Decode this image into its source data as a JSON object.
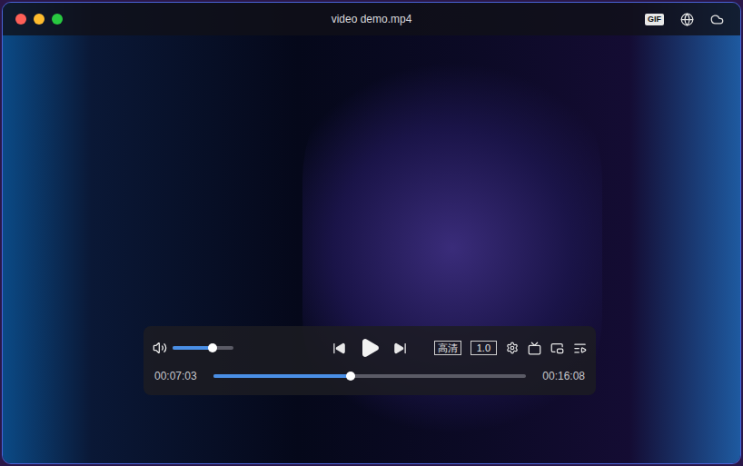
{
  "window": {
    "title": "video demo.mp4"
  },
  "toolbar": {
    "badges": [
      "GIF"
    ]
  },
  "player": {
    "volume": {
      "level": 0.66
    },
    "playing": false,
    "quality": "高清",
    "speed": "1.0",
    "current_time": "00:07:03",
    "duration": "00:16:08",
    "progress": {
      "level": 0.44
    }
  }
}
